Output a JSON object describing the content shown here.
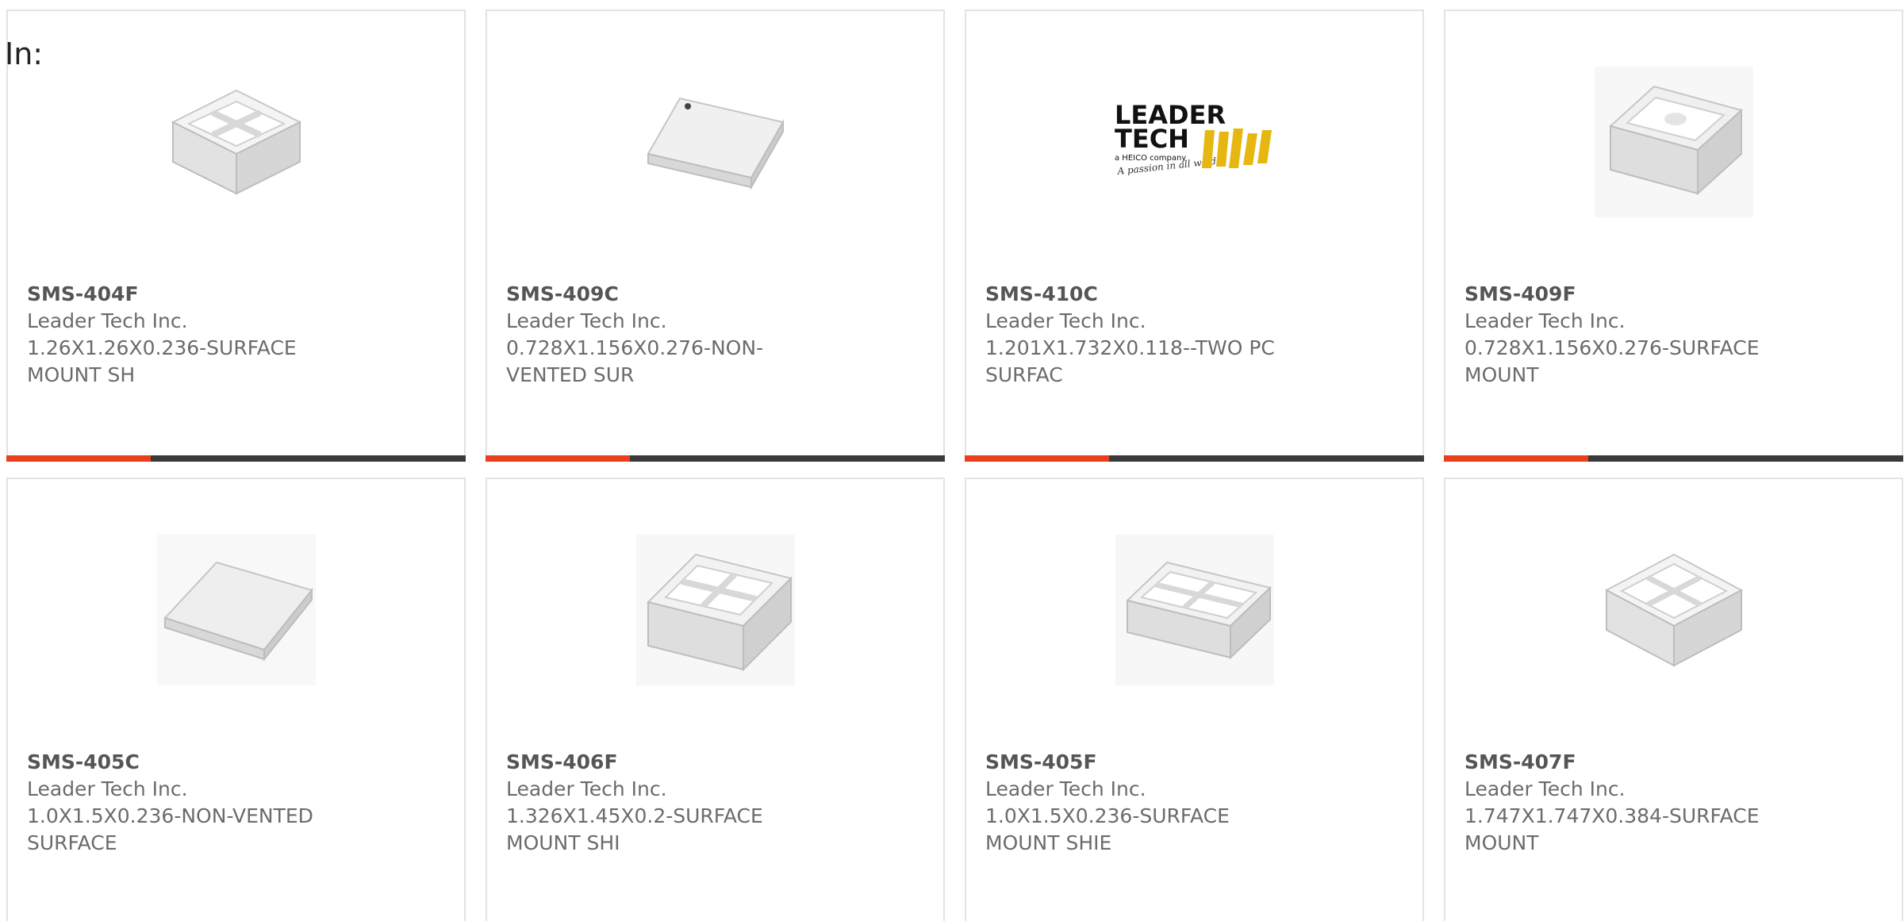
{
  "filter_label": "In:",
  "colors": {
    "accent": "#e8401c",
    "bar": "#3a3a3a",
    "text": "#6b6b6b",
    "border": "#e3e3e3",
    "logo_yellow": "#e6b711"
  },
  "products": [
    {
      "part_number": "SMS-404F",
      "manufacturer": "Leader Tech Inc.",
      "description": "1.26X1.26X0.236-SURFACE MOUNT SH",
      "image": "shield-frame-square-icon"
    },
    {
      "part_number": "SMS-409C",
      "manufacturer": "Leader Tech Inc.",
      "description": "0.728X1.156X0.276-NON-VENTED SUR",
      "image": "shield-cover-icon"
    },
    {
      "part_number": "SMS-410C",
      "manufacturer": "Leader Tech Inc.",
      "description": "1.201X1.732X0.118--TWO PC SURFAC",
      "image": "leader-tech-logo",
      "logo": {
        "line1": "LEADER",
        "line2": "TECH",
        "tagline": "a HEICO company",
        "script": "A passion in all we do"
      }
    },
    {
      "part_number": "SMS-409F",
      "manufacturer": "Leader Tech Inc.",
      "description": "0.728X1.156X0.276-SURFACE MOUNT",
      "image": "shield-frame-rect-icon"
    },
    {
      "part_number": "SMS-405C",
      "manufacturer": "Leader Tech Inc.",
      "description": "1.0X1.5X0.236-NON-VENTED SURFACE",
      "image": "shield-cover-icon"
    },
    {
      "part_number": "SMS-406F",
      "manufacturer": "Leader Tech Inc.",
      "description": "1.326X1.45X0.2-SURFACE MOUNT SHI",
      "image": "shield-frame-square-icon"
    },
    {
      "part_number": "SMS-405F",
      "manufacturer": "Leader Tech Inc.",
      "description": "1.0X1.5X0.236-SURFACE MOUNT SHIE",
      "image": "shield-frame-rect-icon"
    },
    {
      "part_number": "SMS-407F",
      "manufacturer": "Leader Tech Inc.",
      "description": "1.747X1.747X0.384-SURFACE MOUNT",
      "image": "shield-frame-square-icon"
    }
  ]
}
